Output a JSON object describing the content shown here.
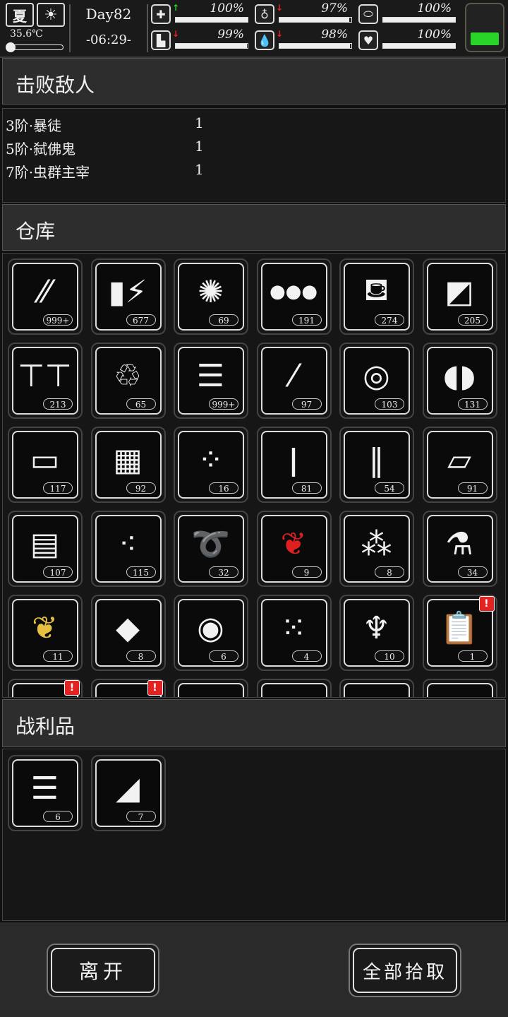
{
  "status": {
    "season": "夏",
    "temperature": "35.6℃",
    "day": "Day82",
    "time": "-06:29-",
    "stats": [
      {
        "icon": "medkit-icon",
        "glyph": "✚",
        "arrow": "↑",
        "arrow_color": "#22dd22",
        "pct": "100%",
        "level": 1.0
      },
      {
        "icon": "stomach-icon",
        "glyph": "♁",
        "arrow": "↓",
        "arrow_color": "#ee2222",
        "pct": "97%",
        "level": 0.97
      },
      {
        "icon": "pill-icon",
        "glyph": "⬭",
        "arrow": "",
        "arrow_color": "#eee",
        "pct": "100%",
        "level": 1.0
      },
      {
        "icon": "foot-icon",
        "glyph": "▙",
        "arrow": "↓",
        "arrow_color": "#ee2222",
        "pct": "99%",
        "level": 0.99
      },
      {
        "icon": "water-drop-icon",
        "glyph": "💧",
        "arrow": "↓",
        "arrow_color": "#ee2222",
        "pct": "98%",
        "level": 0.98
      },
      {
        "icon": "heart-icon",
        "glyph": "♥",
        "arrow": "",
        "arrow_color": "#eee",
        "pct": "100%",
        "level": 1.0
      }
    ],
    "battery_color": "#27d427"
  },
  "enemies_section": {
    "title": "击败敌人",
    "rows": [
      {
        "name": "3阶·暴徒",
        "count": "1"
      },
      {
        "name": "5阶·弑佛鬼",
        "count": "1"
      },
      {
        "name": "7阶·虫群主宰",
        "count": "1"
      }
    ]
  },
  "warehouse": {
    "title": "仓库",
    "items": [
      {
        "icon": "bullets-icon",
        "glyph": "⁄⁄",
        "count": "999+"
      },
      {
        "icon": "battery-icon",
        "glyph": "▮⚡",
        "count": "677"
      },
      {
        "icon": "cotton-icon",
        "glyph": "✺",
        "count": "69"
      },
      {
        "icon": "cotton-balls-icon",
        "glyph": "●●●",
        "count": "191"
      },
      {
        "icon": "spray-bottle-icon",
        "glyph": "⛾",
        "count": "274"
      },
      {
        "icon": "cloth-scraps-icon",
        "glyph": "◩",
        "count": "205"
      },
      {
        "icon": "screws-icon",
        "glyph": "⊤⊤",
        "count": "213"
      },
      {
        "icon": "plastic-bottle-icon",
        "glyph": "♲",
        "count": "65"
      },
      {
        "icon": "folded-cloth-icon",
        "glyph": "☰",
        "count": "999+"
      },
      {
        "icon": "glass-bottle-icon",
        "glyph": "⁄",
        "count": "97"
      },
      {
        "icon": "bandage-roll-icon",
        "glyph": "◎",
        "count": "103"
      },
      {
        "icon": "capsules-icon",
        "glyph": "◖◗",
        "count": "131"
      },
      {
        "icon": "tin-cans-icon",
        "glyph": "▭",
        "count": "117"
      },
      {
        "icon": "ice-cubes-icon",
        "glyph": "▦",
        "count": "92"
      },
      {
        "icon": "seeds-icon",
        "glyph": "⁘",
        "count": "16"
      },
      {
        "icon": "blade-icon",
        "glyph": "ǀ",
        "count": "81"
      },
      {
        "icon": "tubes-icon",
        "glyph": "‖",
        "count": "54"
      },
      {
        "icon": "towel-icon",
        "glyph": "▱",
        "count": "91"
      },
      {
        "icon": "wood-blocks-icon",
        "glyph": "▤",
        "count": "107"
      },
      {
        "icon": "rubble-icon",
        "glyph": "⁖",
        "count": "115"
      },
      {
        "icon": "rope-icon",
        "glyph": "➰",
        "count": "32"
      },
      {
        "icon": "red-leaves-icon",
        "glyph": "❦",
        "count": "9",
        "color": "#e02020"
      },
      {
        "icon": "sunflower-seeds-icon",
        "glyph": "⁂",
        "count": "8"
      },
      {
        "icon": "medicine-bottle-icon",
        "glyph": "⚗",
        "count": "34"
      },
      {
        "icon": "yellow-leaves-icon",
        "glyph": "❦",
        "count": "11",
        "color": "#e8c040"
      },
      {
        "icon": "crackers-icon",
        "glyph": "◆",
        "count": "8"
      },
      {
        "icon": "lemon-slice-icon",
        "glyph": "◉",
        "count": "6"
      },
      {
        "icon": "beans-icon",
        "glyph": "⁙",
        "count": "4"
      },
      {
        "icon": "ginger-root-icon",
        "glyph": "♆",
        "count": "10"
      },
      {
        "icon": "clipboard-icon",
        "glyph": "📋",
        "count": "1",
        "alert": "!"
      },
      {
        "icon": "item-partial-1-icon",
        "glyph": "",
        "count": "",
        "alert": "!"
      },
      {
        "icon": "item-partial-2-icon",
        "glyph": "",
        "count": "",
        "alert": "!"
      },
      {
        "icon": "item-partial-3-icon",
        "glyph": "",
        "count": ""
      },
      {
        "icon": "item-partial-4-icon",
        "glyph": "",
        "count": ""
      },
      {
        "icon": "item-partial-5-icon",
        "glyph": "",
        "count": ""
      },
      {
        "icon": "item-partial-6-icon",
        "glyph": "",
        "count": ""
      }
    ]
  },
  "loot": {
    "title": "战利品",
    "items": [
      {
        "icon": "folded-cloth-icon",
        "glyph": "☰",
        "count": "6"
      },
      {
        "icon": "meat-pack-icon",
        "glyph": "◢",
        "count": "7"
      }
    ]
  },
  "buttons": {
    "leave": "离开",
    "take_all": "全部拾取"
  }
}
